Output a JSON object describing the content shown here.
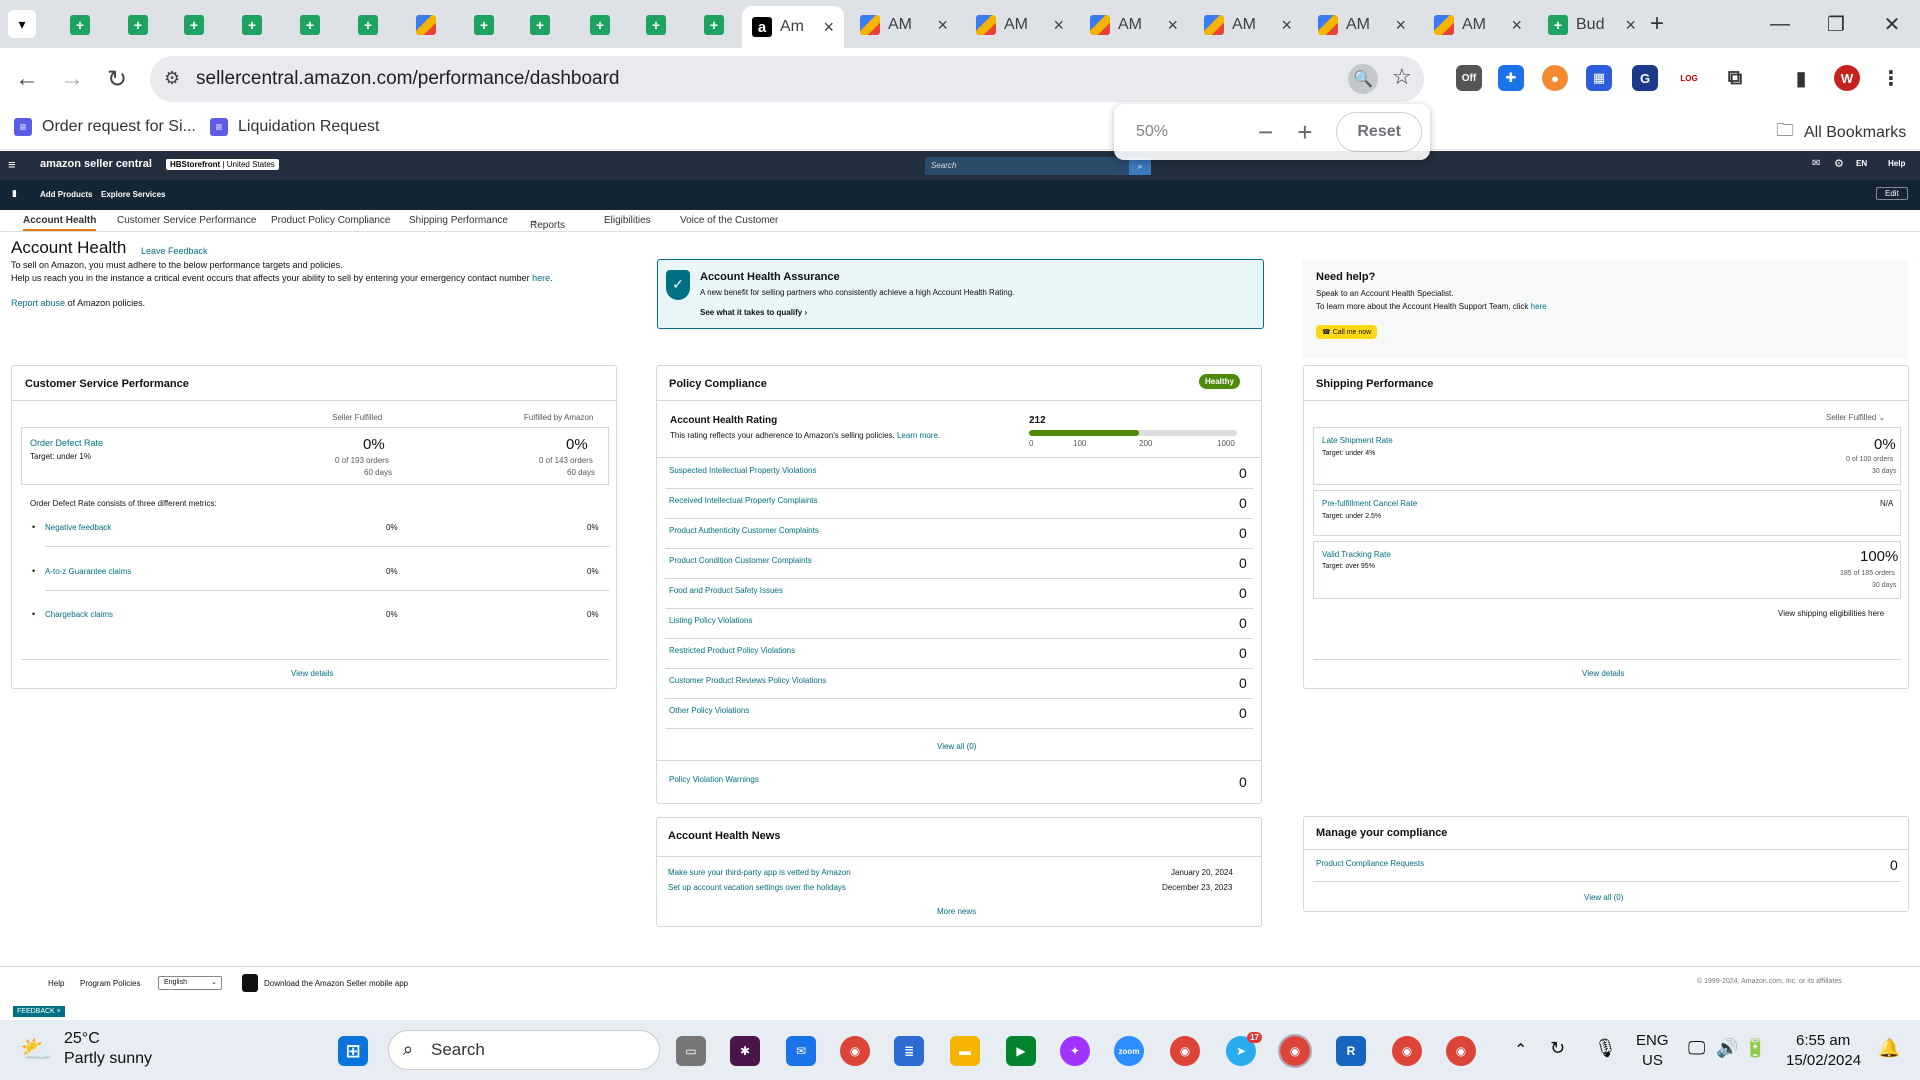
{
  "browser": {
    "tabs": [
      {
        "title": "",
        "type": "sheet"
      },
      {
        "title": "",
        "type": "sheet"
      },
      {
        "title": "",
        "type": "sheet"
      },
      {
        "title": "",
        "type": "sheet"
      },
      {
        "title": "",
        "type": "sheet"
      },
      {
        "title": "",
        "type": "sheet"
      },
      {
        "title": "",
        "type": "pen"
      },
      {
        "title": "",
        "type": "sheet"
      },
      {
        "title": "",
        "type": "sheet"
      },
      {
        "title": "",
        "type": "sheet"
      },
      {
        "title": "",
        "type": "sheet"
      },
      {
        "title": "",
        "type": "sheet"
      },
      {
        "title": "Am",
        "type": "amazon",
        "active": true
      },
      {
        "title": "AM",
        "type": "pen"
      },
      {
        "title": "AM",
        "type": "pen"
      },
      {
        "title": "AM",
        "type": "pen"
      },
      {
        "title": "AM",
        "type": "pen"
      },
      {
        "title": "AM",
        "type": "pen"
      },
      {
        "title": "AM",
        "type": "pen"
      },
      {
        "title": "Bud",
        "type": "sheet"
      }
    ],
    "url": "sellercentral.amazon.com/performance/dashboard",
    "profile_initial": "W",
    "bookmarks": [
      "Order request for Si...",
      "Liquidation Request"
    ],
    "all_bookmarks": "All Bookmarks",
    "zoom": {
      "value": "50%",
      "reset": "Reset",
      "minus": "−",
      "plus": "+"
    }
  },
  "seller": {
    "logo": "amazon seller central",
    "store": "HBStorefront",
    "country": "United States",
    "search_placeholder": "Search",
    "lang": "EN",
    "help": "Help",
    "sub_nav": [
      "Add Products",
      "Explore Services"
    ],
    "edit": "Edit",
    "tabs": [
      "Account Health",
      "Customer Service Performance",
      "Product Policy Compliance",
      "Shipping Performance",
      "Reports",
      "Eligibilities",
      "Voice of the Customer"
    ]
  },
  "page": {
    "title": "Account Health",
    "feedback": "Leave Feedback",
    "intro1": "To sell on Amazon, you must adhere to the below performance targets and policies.",
    "intro2": "Help us reach you in the instance a critical event occurs that affects your ability to sell by entering your emergency contact number",
    "intro2_link": "here",
    "report_link": "Report abuse",
    "report_rest": "of Amazon policies."
  },
  "assurance": {
    "title": "Account Health Assurance",
    "desc": "A new benefit for selling partners who consistently achieve a high Account Health Rating.",
    "link": "See what it takes to qualify"
  },
  "help_box": {
    "title": "Need help?",
    "line1": "Speak to an Account Health Specialist.",
    "line2": "To learn more about the Account Health Support Team, click",
    "line2_link": "here",
    "button": "Call me now"
  },
  "csp": {
    "title": "Customer Service Performance",
    "col1": "Seller Fulfilled",
    "col2": "Fulfilled by Amazon",
    "odr_label": "Order Defect Rate",
    "odr_target": "Target: under 1%",
    "odr_sf": "0%",
    "odr_sf_orders": "0 of 193 orders",
    "odr_sf_days": "60 days",
    "odr_fba": "0%",
    "odr_fba_orders": "0 of 143 orders",
    "odr_fba_days": "60 days",
    "metrics_intro": "Order Defect Rate consists of three different metrics:",
    "metrics": [
      {
        "label": "Negative feedback",
        "sf": "0%",
        "fba": "0%"
      },
      {
        "label": "A-to-z Guarantee claims",
        "sf": "0%",
        "fba": "0%"
      },
      {
        "label": "Chargeback claims",
        "sf": "0%",
        "fba": "0%"
      }
    ],
    "view": "View details"
  },
  "policy": {
    "title": "Policy Compliance",
    "badge": "Healthy",
    "ahr_title": "Account Health Rating",
    "ahr_desc": "This rating reflects your adherence to Amazon's selling policies.",
    "ahr_learn": "Learn more.",
    "ahr_value": "212",
    "ahr_scale": [
      "0",
      "100",
      "200",
      "1000"
    ],
    "ahr_fraction": 0.53,
    "items": [
      {
        "label": "Suspected Intellectual Property Violations",
        "value": "0"
      },
      {
        "label": "Received Intellectual Property Complaints",
        "value": "0"
      },
      {
        "label": "Product Authenticity Customer Complaints",
        "value": "0"
      },
      {
        "label": "Product Condition Customer Complaints",
        "value": "0"
      },
      {
        "label": "Food and Product Safety Issues",
        "value": "0"
      },
      {
        "label": "Listing Policy Violations",
        "value": "0"
      },
      {
        "label": "Restricted Product Policy Violations",
        "value": "0"
      },
      {
        "label": "Customer Product Reviews Policy Violations",
        "value": "0"
      },
      {
        "label": "Other Policy Violations",
        "value": "0"
      }
    ],
    "view_all": "View all (0)",
    "warnings_label": "Policy Violation Warnings",
    "warnings_value": "0"
  },
  "news": {
    "title": "Account Health News",
    "items": [
      {
        "label": "Make sure your third-party app is vetted by Amazon",
        "date": "January 20, 2024"
      },
      {
        "label": "Set up account vacation settings over the holidays",
        "date": "December 23, 2023"
      }
    ],
    "more": "More news"
  },
  "shipping": {
    "title": "Shipping Performance",
    "filter": "Seller Fulfilled",
    "items": [
      {
        "label": "Late Shipment Rate",
        "target": "Target: under 4%",
        "value": "0%",
        "orders": "0 of 100 orders",
        "days": "30 days"
      },
      {
        "label": "Pre-fulfillment Cancel Rate",
        "target": "Target: under 2.5%",
        "value": "N/A",
        "orders": "",
        "days": ""
      },
      {
        "label": "Valid Tracking Rate",
        "target": "Target: over 95%",
        "value": "100%",
        "orders": "185 of 185 orders",
        "days": "30 days"
      }
    ],
    "eligibility": "View shipping eligibilities here",
    "view": "View details"
  },
  "compliance": {
    "title": "Manage your compliance",
    "item": "Product Compliance Requests",
    "value": "0",
    "view_all": "View all (0)"
  },
  "footer": {
    "help": "Help",
    "program": "Program Policies",
    "lang": "English",
    "app": "Download the Amazon Seller mobile app",
    "copyright": "© 1999-2024, Amazon.com, Inc. or its affiliates",
    "feedback": "FEEDBACK"
  },
  "taskbar": {
    "temp": "25°C",
    "weather": "Partly sunny",
    "search": "Search",
    "lang1": "ENG",
    "lang2": "US",
    "time": "6:55 am",
    "date": "15/02/2024",
    "telegram_badge": "17"
  },
  "colors": {
    "accent": "#007185",
    "header": "#232f3e",
    "healthy": "#4d8a0a",
    "yellow": "#ffd814"
  }
}
